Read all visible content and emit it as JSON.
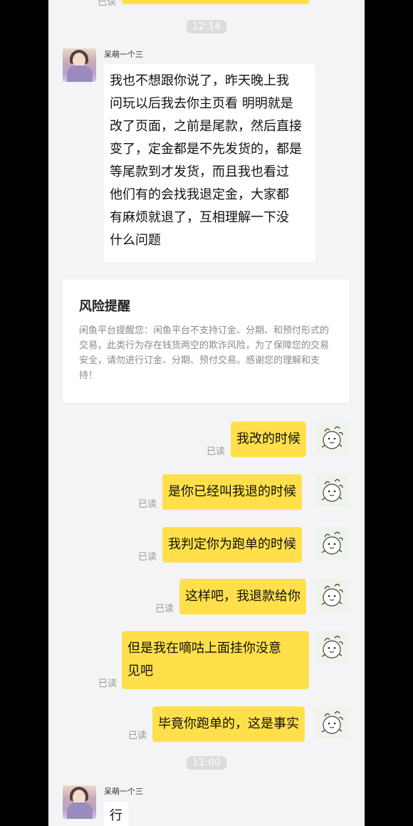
{
  "colors": {
    "chat_bg": "#f4f4f6",
    "my_bubble": "#ffe04a",
    "their_bubble": "#ffffff",
    "read_text": "#999999",
    "time_pill": "#dcdcdf"
  },
  "top": {
    "read_label_partial": "已读"
  },
  "times": [
    "12:14",
    "13:00"
  ],
  "sender_name": "呆萌一个三",
  "their_messages": [
    "我也不想跟你说了，昨天晚上我\n问玩以后我去你主页看 明明就是\n改了页面，之前是尾款，然后直接\n变了，定金都是不先发货的，都是\n等尾款到才发货，而且我也看过\n他们有的会找我退定金，大家都\n有麻烦就退了，互相理解一下没\n什么问题",
    "行"
  ],
  "risk_notice": {
    "title": "风险提醒",
    "body": "闲鱼平台提醒您：闲鱼平台不支持订金、分期、和预付形式的交易，此类行为存在钱货两空的欺诈风险，为了保障您的交易安全，请勿进行订金、分期、预付交易。感谢您的理解和支持！"
  },
  "my_messages": [
    {
      "text": "我改的时候",
      "status": "已读"
    },
    {
      "text": "是你已经叫我退的时候",
      "status": "已读"
    },
    {
      "text": "我判定你为跑单的时候",
      "status": "已读"
    },
    {
      "text": "这样吧，我退款给你",
      "status": "已读"
    },
    {
      "text": "但是我在嘀咕上面挂你没意\n见吧",
      "status": "已读"
    },
    {
      "text": "毕竟你跑单的，这是事实",
      "status": "已读"
    }
  ],
  "icons": {
    "their_avatar": "user-photo-avatar",
    "my_avatar": "cartoon-avatar"
  }
}
